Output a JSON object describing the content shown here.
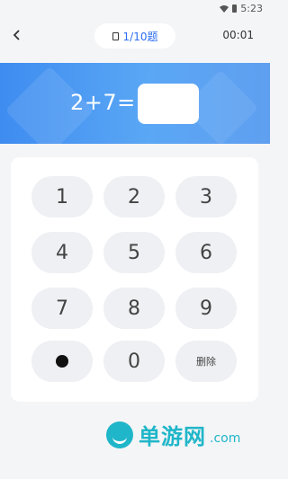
{
  "status": {
    "time": "5:23"
  },
  "header": {
    "back_icon": "chevron-left-icon",
    "progress": "1/10题",
    "timer": "00:01"
  },
  "question": {
    "equation": "2+7=",
    "answer": ""
  },
  "keypad": {
    "keys": [
      "1",
      "2",
      "3",
      "4",
      "5",
      "6",
      "7",
      "8",
      "9",
      "",
      "0",
      "删除"
    ]
  },
  "watermark": {
    "brand": "单游网",
    "domain": ".com"
  }
}
